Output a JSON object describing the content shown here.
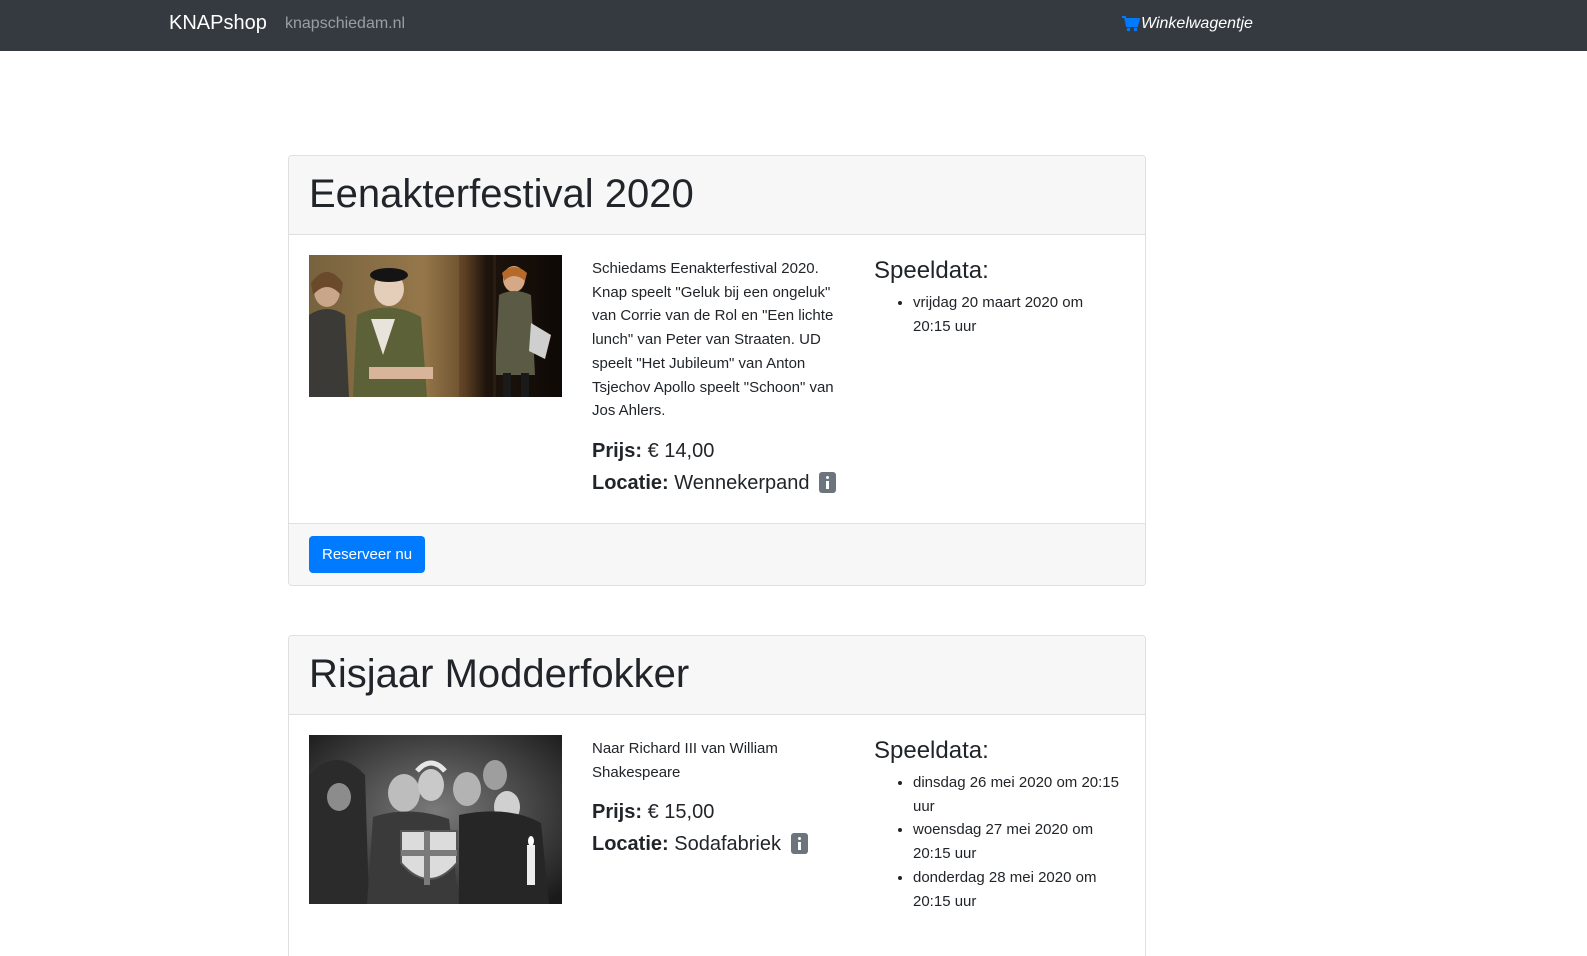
{
  "nav": {
    "brand": "KNAPshop",
    "link": "knapschiedam.nl",
    "cart_label": "Winkelwagentje"
  },
  "productions": [
    {
      "title": "Eenakterfestival 2020",
      "description": "Schiedams Eenakterfestival 2020. Knap speelt \"Geluk bij een ongeluk\" van Corrie van de Rol en \"Een lichte lunch\" van Peter van Straaten. UD speelt \"Het Jubileum\" van Anton Tsjechov Apollo speelt \"Schoon\" van Jos Ahlers.",
      "price_label": "Prijs:",
      "price": "€ 14,00",
      "location_label": "Locatie:",
      "location": "Wennekerpand",
      "dates_heading": "Speeldata:",
      "dates": [
        "vrijdag 20 maart 2020 om 20:15 uur"
      ],
      "button": "Reserveer nu"
    },
    {
      "title": "Risjaar Modderfokker",
      "description": "Naar Richard III van William Shakespeare",
      "price_label": "Prijs:",
      "price": "€ 15,00",
      "location_label": "Locatie:",
      "location": "Sodafabriek",
      "dates_heading": "Speeldata:",
      "dates": [
        "dinsdag 26 mei 2020 om 20:15 uur",
        "woensdag 27 mei 2020 om 20:15 uur",
        "donderdag 28 mei 2020 om 20:15 uur"
      ]
    }
  ],
  "colors": {
    "navbar": "#343a40",
    "primary": "#007bff",
    "card_header": "#f7f7f7",
    "info_icon": "#6c757d"
  },
  "icons": {
    "cart": "shopping-cart-icon",
    "info": "info-icon"
  }
}
